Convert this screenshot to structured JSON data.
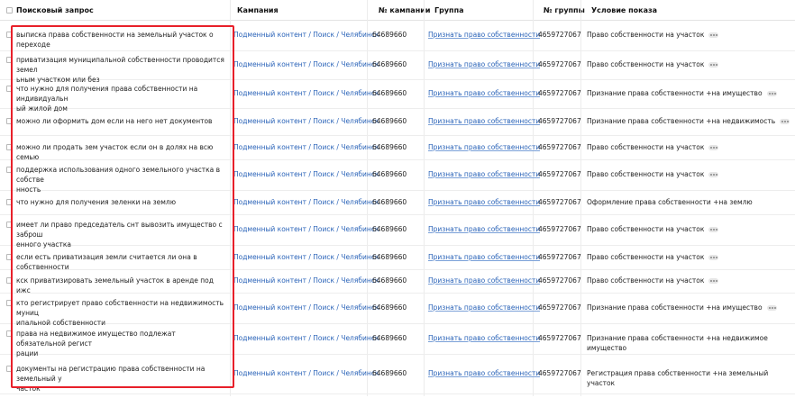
{
  "headers": {
    "query": "Поисковый запрос",
    "campaign": "Кампания",
    "campaign_id": "№ кампании",
    "group": "Группа",
    "group_id": "№ группы",
    "condition": "Условие показа"
  },
  "rows": [
    {
      "query": [
        "выписка права собственности на земельный участок о переходе"
      ],
      "campaign": "Подменный контент / Поиск / Челябинск",
      "campaign_id": "64689660",
      "group": "Признать право собственности",
      "group_id": "4659727067",
      "condition": "Право собственности на участок"
    },
    {
      "query": [
        "приватизация муниципальной собственности проводится земел",
        "ьным участком или без"
      ],
      "campaign": "Подменный контент / Поиск / Челябинск",
      "campaign_id": "64689660",
      "group": "Признать право собственности",
      "group_id": "4659727067",
      "condition": "Право собственности на участок"
    },
    {
      "query": [
        "что нужно для получения права собственности на индивидуальн",
        "ый жилой дом"
      ],
      "campaign": "Подменный контент / Поиск / Челябинск",
      "campaign_id": "64689660",
      "group": "Признать право собственности",
      "group_id": "4659727067",
      "condition": "Признание права собственности +на имущество"
    },
    {
      "query": [
        "можно ли оформить дом если на него нет документов"
      ],
      "campaign": "Подменный контент / Поиск / Челябинск",
      "campaign_id": "64689660",
      "group": "Признать право собственности",
      "group_id": "4659727067",
      "condition": "Признание права собственности +на недвижимость"
    },
    {
      "query": [
        "можно ли продать зем участок если он в долях на всю семью"
      ],
      "campaign": "Подменный контент / Поиск / Челябинск",
      "campaign_id": "64689660",
      "group": "Признать право собственности",
      "group_id": "4659727067",
      "condition": "Право собственности на участок"
    },
    {
      "query": [
        "поддержка использования одного земельного участка в собстве",
        "нность"
      ],
      "campaign": "Подменный контент / Поиск / Челябинск",
      "campaign_id": "64689660",
      "group": "Признать право собственности",
      "group_id": "4659727067",
      "condition": "Право собственности на участок"
    },
    {
      "query": [
        "что нужно для получения зеленки на землю"
      ],
      "campaign": "Подменный контент / Поиск / Челябинск",
      "campaign_id": "64689660",
      "group": "Признать право собственности",
      "group_id": "4659727067",
      "condition": "Оформление права собственности +на землю"
    },
    {
      "query": [
        "имеет ли право председатель снт вывозить имущество с заброш",
        "енного участка"
      ],
      "campaign": "Подменный контент / Поиск / Челябинск",
      "campaign_id": "64689660",
      "group": "Признать право собственности",
      "group_id": "4659727067",
      "condition": "Право собственности на участок"
    },
    {
      "query": [
        "если есть приватизация земли считается ли она в собственности"
      ],
      "campaign": "Подменный контент / Поиск / Челябинск",
      "campaign_id": "64689660",
      "group": "Признать право собственности",
      "group_id": "4659727067",
      "condition": "Право собственности на участок"
    },
    {
      "query": [
        "кск приватизировать земельный участок в аренде под ижс"
      ],
      "campaign": "Подменный контент / Поиск / Челябинск",
      "campaign_id": "64689660",
      "group": "Признать право собственности",
      "group_id": "4659727067",
      "condition": "Право собственности на участок"
    },
    {
      "query": [
        "кто регистрирует право собственности на недвижимость муниц",
        "ипальной собственности"
      ],
      "campaign": "Подменный контент / Поиск / Челябинск",
      "campaign_id": "64689660",
      "group": "Признать право собственности",
      "group_id": "4659727067",
      "condition": "Признание права собственности +на имущество"
    },
    {
      "query": [
        "права на недвижимое имущество подлежат обязательной регист",
        "рации"
      ],
      "campaign": "Подменный контент / Поиск / Челябинск",
      "campaign_id": "64689660",
      "group": "Признать право собственности",
      "group_id": "4659727067",
      "condition": "Признание права собственности +на недвижимое имущество"
    },
    {
      "query": [
        "документы на регистрацию права собственности на земельный у",
        "часток"
      ],
      "campaign": "Подменный контент / Поиск / Челябинск",
      "campaign_id": "64689660",
      "group": "Признать право собственности",
      "group_id": "4659727067",
      "condition": "Регистрация права собственности +на земельный участок"
    }
  ],
  "condition_more_flags": [
    true,
    true,
    true,
    true,
    true,
    true,
    false,
    true,
    true,
    true,
    true,
    false,
    false
  ],
  "highlight_color": "#e8202a",
  "link_color": "#2a63b8"
}
